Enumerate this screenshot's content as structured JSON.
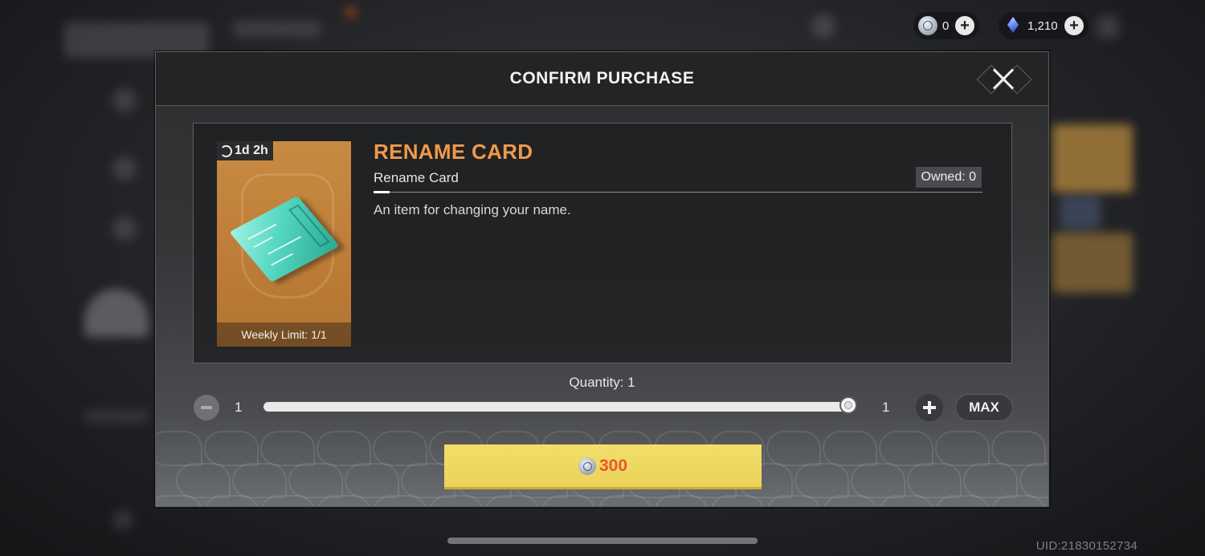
{
  "currency": {
    "silver": {
      "value": "0",
      "icon": "silver-coin-icon"
    },
    "crystal": {
      "value": "1,210",
      "icon": "crystal-icon"
    }
  },
  "dialog": {
    "title": "CONFIRM PURCHASE",
    "item": {
      "name": "RENAME CARD",
      "subtitle": "Rename Card",
      "owned": "Owned: 0",
      "description": "An item for changing your name.",
      "timer": "1d 2h",
      "weekly_limit": "Weekly Limit: 1/1",
      "image": "rename-card-chip-icon"
    },
    "quantity": {
      "label": "Quantity: 1",
      "min": "1",
      "max": "1",
      "max_button": "MAX",
      "fill_fraction": 1.0
    },
    "buy": {
      "price": "300",
      "icon": "silver-coin-icon"
    }
  },
  "footer": {
    "uid": "UID:21830152734"
  },
  "colors": {
    "accent_orange": "#ef9a4a",
    "buy_button": "#ecd35a",
    "price_text": "#e8582c",
    "card_bg": "#c88a43"
  }
}
